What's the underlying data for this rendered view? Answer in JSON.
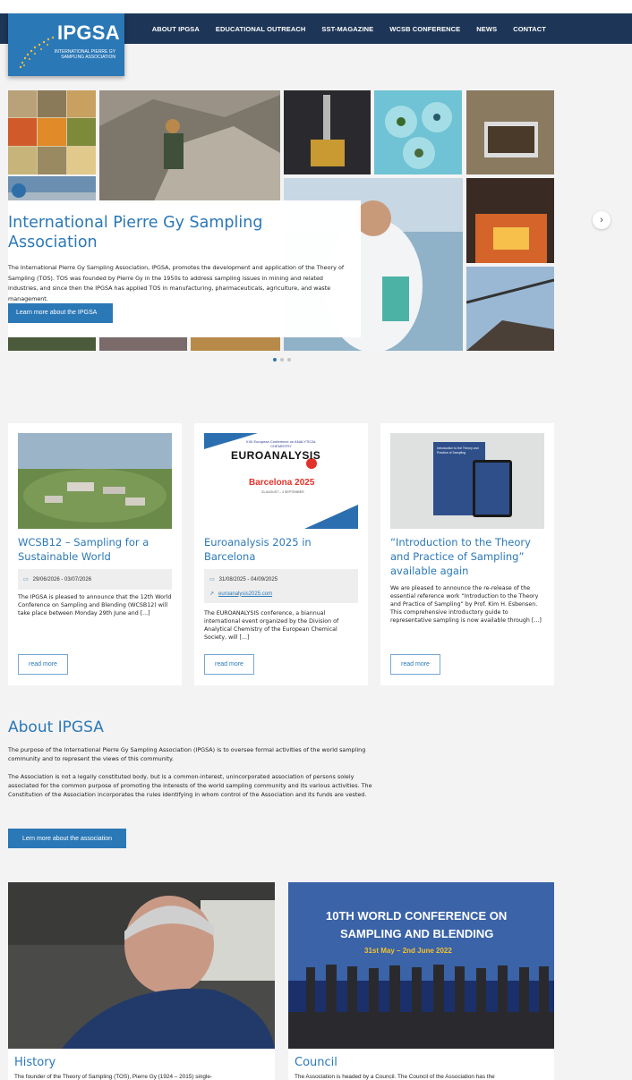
{
  "nav": {
    "logo_text": "IPGSA",
    "logo_subtitle": "INTERNATIONAL PIERRE GY SAMPLING ASSOCIATION",
    "items": [
      {
        "label": "ABOUT IPGSA"
      },
      {
        "label": "EDUCATIONAL OUTREACH"
      },
      {
        "label": "SST-MAGAZINE"
      },
      {
        "label": "WCSB CONFERENCE"
      },
      {
        "label": "NEWS"
      },
      {
        "label": "CONTACT"
      }
    ]
  },
  "hero": {
    "title": "International Pierre Gy Sampling Association",
    "text": "The International Pierre Gy Sampling Association, IPGSA, promotes the development and application of the Theory of Sampling (TOS). TOS was founded by Pierre Gy in the 1950s to address sampling issues in mining and related industries, and since then the IPGSA has applied TOS in manufacturing, pharmaceuticals, agriculture, and waste management.",
    "button": "Learn more about the IPGSA",
    "next_icon": "chevron-right-icon",
    "slides": 3,
    "active_slide": 1
  },
  "news": [
    {
      "title": "WCSB12 – Sampling for a Sustainable World",
      "date": "29/06/2026 - 03/07/2026",
      "text": "The IPGSA is pleased to announce that the 12th World Conference on Sampling and Blending (WCSB12) will take place between Monday 29th June and [...]",
      "button": "read more"
    },
    {
      "title": "Euroanalysis 2025 in Barcelona",
      "date": "31/08/2025 - 04/09/2025",
      "link": "euroanalysis2025.com",
      "image_text": {
        "top": "XXII European Conference on ANALYTICAL CHEMISTRY",
        "brand": "EUROANALYSIS",
        "city": "Barcelona 2025",
        "dates": "31 AUGUST – 4 SEPTEMBER"
      },
      "text": "The EUROANALYSIS conference, a biannual international event organized by the Division of Analytical Chemistry of the European Chemical Society, will [...]",
      "button": "read more"
    },
    {
      "title": "“Introduction to the Theory and Practice of Sampling” available again",
      "book_text": "Introduction to the Theory and Practice of Sampling",
      "text": "We are pleased to announce the re-release of the essential reference work “Introduction to the Theory and Practice of Sampling” by Prof. Kim H. Esbensen. This comprehensive introductory guide to representative sampling is now available through [...]",
      "button": "read more"
    }
  ],
  "about": {
    "title": "About IPGSA",
    "p1": "The purpose of the International Pierre Gy Sampling Association (IPGSA) is to oversee formal activities of the world sampling community and to represent the views of this community.",
    "p2": "The Association is not a legally constituted body, but is a common-interest, unincorporated association of persons solely associated for the common purpose of promoting the interests of the world sampling community and its various activities. The Constitution of the Association incorporates the rules identifying in whom control of the Association and its funds are vested.",
    "button": "Lern more about the association"
  },
  "bottom": [
    {
      "title": "History",
      "text": "The founder of the Theory of Sampling (TOS), Pierre Gy (1924 – 2015) single-"
    },
    {
      "title": "Council",
      "text": "The Association is headed by a Council. The Council of the Association has the",
      "banner_line1": "10TH WORLD CONFERENCE ON",
      "banner_line2": "SAMPLING AND BLENDING",
      "banner_line3": "31st May – 2nd June 2022"
    }
  ],
  "colors": {
    "brand_blue": "#2b78b7",
    "nav_bg": "#1d3557",
    "page_bg": "#f3f3f3"
  }
}
